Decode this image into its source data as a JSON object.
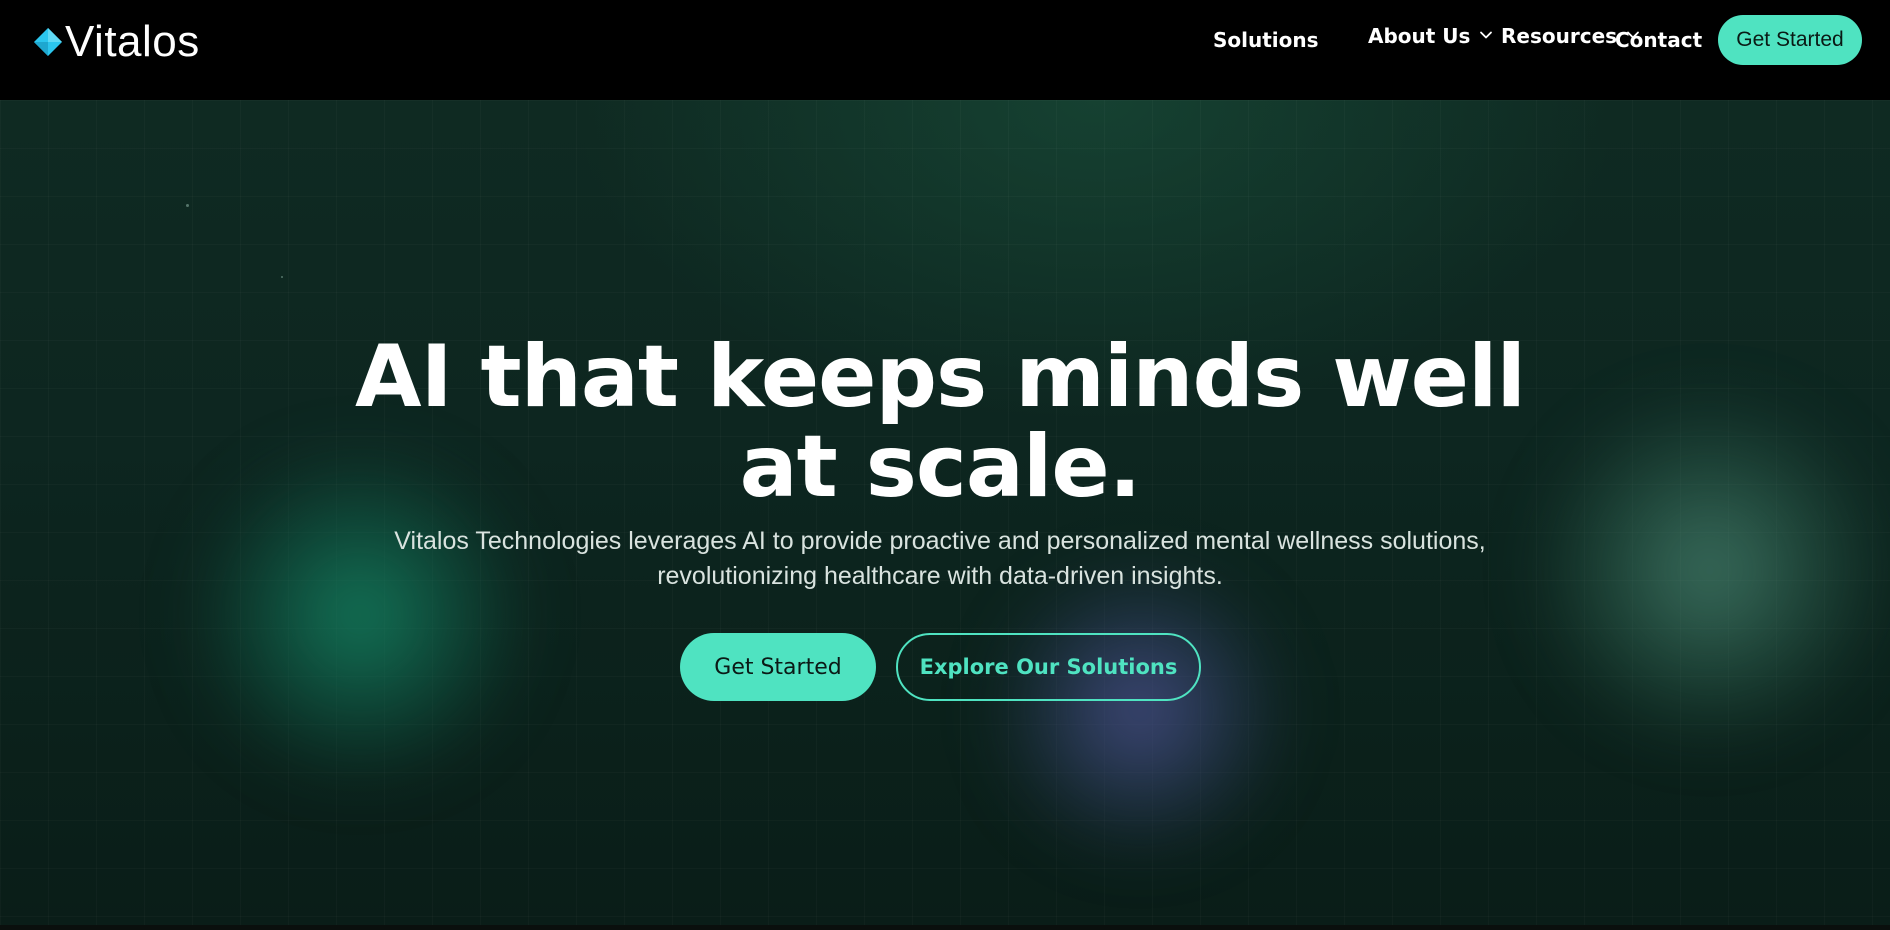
{
  "brand": {
    "name": "Vitalos",
    "logo_icon": "diamond-icon",
    "logo_color": "#2bc6ee"
  },
  "nav": {
    "items": [
      {
        "label": "Solutions",
        "has_dropdown": false
      },
      {
        "label": "About Us",
        "has_dropdown": true
      },
      {
        "label": "Resources",
        "has_dropdown": true
      },
      {
        "label": "Contact",
        "has_dropdown": false
      }
    ],
    "cta_label": "Get Started"
  },
  "hero": {
    "headline_line1": "AI that keeps minds well",
    "headline_line2": "at scale.",
    "subtext_line1": "Vitalos Technologies leverages AI to provide proactive and personalized mental wellness solutions,",
    "subtext_line2": "revolutionizing healthcare with data-driven insights.",
    "primary_cta": "Get Started",
    "secondary_cta": "Explore Our Solutions"
  },
  "colors": {
    "accent": "#4fe3c1",
    "background": "#000000",
    "hero_background": "#0d2620"
  }
}
